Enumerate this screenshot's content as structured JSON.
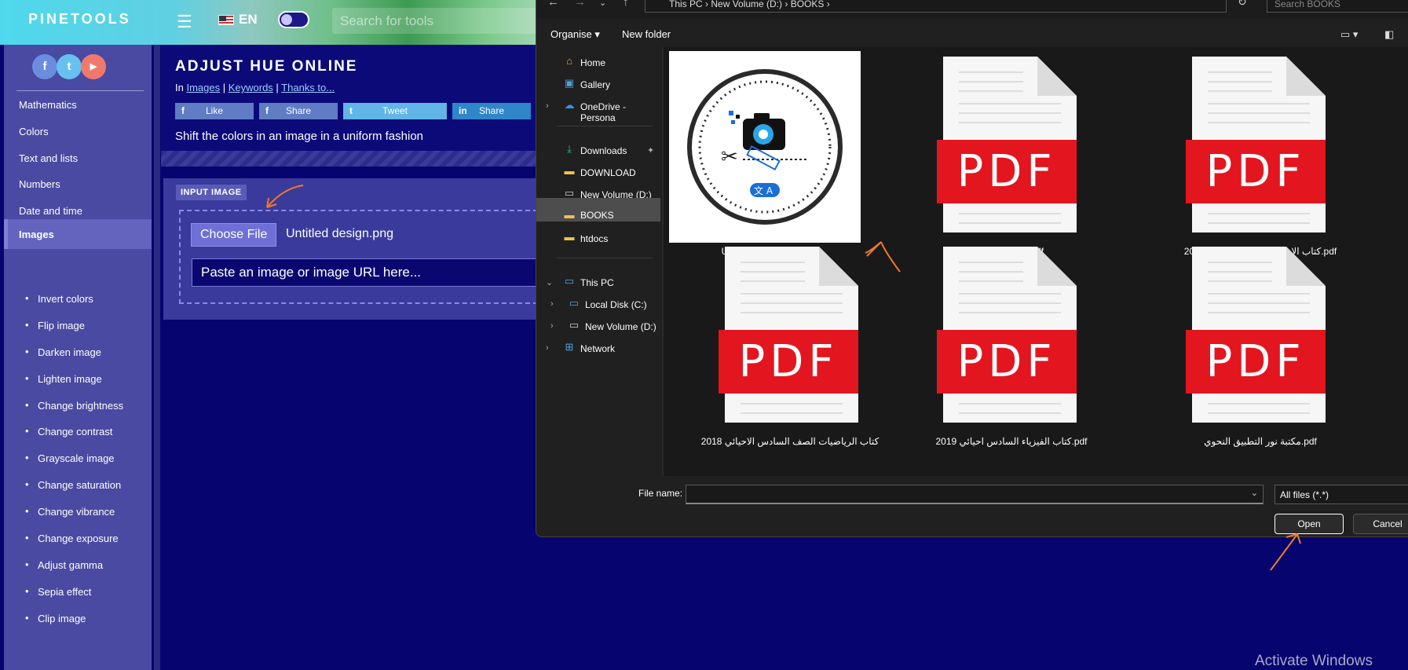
{
  "header": {
    "logo": "PINETOOLS",
    "menu_icon": "hamburger-icon",
    "language": "EN",
    "search_placeholder": "Search for tools"
  },
  "sidebar": {
    "social": [
      "f",
      "t",
      "▶"
    ],
    "categories": [
      {
        "label": "Mathematics",
        "active": false
      },
      {
        "label": "Colors",
        "active": false
      },
      {
        "label": "Text and lists",
        "active": false
      },
      {
        "label": "Numbers",
        "active": false
      },
      {
        "label": "Date and time",
        "active": false
      },
      {
        "label": "Images",
        "active": true
      }
    ],
    "image_tools": [
      "Invert colors",
      "Flip image",
      "Darken image",
      "Lighten image",
      "Change brightness",
      "Change contrast",
      "Grayscale image",
      "Change saturation",
      "Change vibrance",
      "Change exposure",
      "Adjust gamma",
      "Sepia effect",
      "Clip image"
    ]
  },
  "page": {
    "title": "ADJUST HUE ONLINE",
    "crumb_prefix": "In",
    "crumb_links": [
      "Images",
      "Keywords",
      "Thanks to..."
    ],
    "share_buttons": [
      {
        "icon": "f",
        "label": "Like",
        "color": "#5f7cc4"
      },
      {
        "icon": "f",
        "label": "Share",
        "color": "#5f7cc4"
      },
      {
        "icon": "t",
        "label": "Tweet",
        "color": "#62b5e8"
      },
      {
        "icon": "in",
        "label": "Share",
        "color": "#2f86c9"
      }
    ],
    "description": "Shift the colors in an image in a uniform fashion",
    "input_label": "INPUT IMAGE",
    "choose_file": "Choose File",
    "chosen_file": "Untitled design.png",
    "paste_placeholder": "Paste an image or image URL here..."
  },
  "dialog": {
    "breadcrumb": [
      "This PC",
      "New Volume (D:)",
      "BOOKS"
    ],
    "search_placeholder": "Search BOOKS",
    "toolbar": {
      "organise": "Organise",
      "new_folder": "New folder"
    },
    "nav": [
      {
        "label": "Home",
        "icon": "home-icon",
        "color": "#f0a04b"
      },
      {
        "label": "Gallery",
        "icon": "gallery-icon",
        "color": "#4aa3df"
      },
      {
        "label": "OneDrive - Persona",
        "icon": "cloud-icon",
        "color": "#3b8fe0"
      },
      {
        "label": "Downloads",
        "icon": "download-icon",
        "color": "#3dbb7a"
      },
      {
        "label": "DOWNLOAD",
        "icon": "folder-icon",
        "color": "#f2c24b"
      },
      {
        "label": "New Volume (D:)",
        "icon": "drive-icon",
        "color": "#cccccc"
      },
      {
        "label": "BOOKS",
        "icon": "folder-icon",
        "color": "#f2c24b",
        "selected": true
      },
      {
        "label": "htdocs",
        "icon": "folder-icon",
        "color": "#f2c24b"
      },
      {
        "label": "This PC",
        "icon": "pc-icon",
        "color": "#4aa3df"
      },
      {
        "label": "Local Disk (C:)",
        "icon": "drive-icon",
        "color": "#4aa3df"
      },
      {
        "label": "New Volume (D:)",
        "icon": "drive-icon",
        "color": "#cccccc"
      },
      {
        "label": "Network",
        "icon": "network-icon",
        "color": "#4aa3df"
      }
    ],
    "files": [
      {
        "name": "Untitled design.png",
        "kind": "image"
      },
      {
        "name": "ابراهيم حميد.pdf",
        "kind": "pdf"
      },
      {
        "name": "كتاب الاحياء السادس الاحيائي 2020.pdf",
        "kind": "pdf"
      },
      {
        "name": "كتاب الرياضيات الصف السادس الاحيائي 2018",
        "kind": "pdf"
      },
      {
        "name": "كتاب الفيزياء السادس احيائي 2019.pdf",
        "kind": "pdf"
      },
      {
        "name": "مكتبة نور التطبيق النحوي.pdf",
        "kind": "pdf"
      }
    ],
    "pdf_badge": "PDF",
    "file_name_label": "File name:",
    "file_name_value": "",
    "file_type": "All files (*.*)",
    "open": "Open",
    "cancel": "Cancel"
  },
  "watermark": "Activate Windows"
}
